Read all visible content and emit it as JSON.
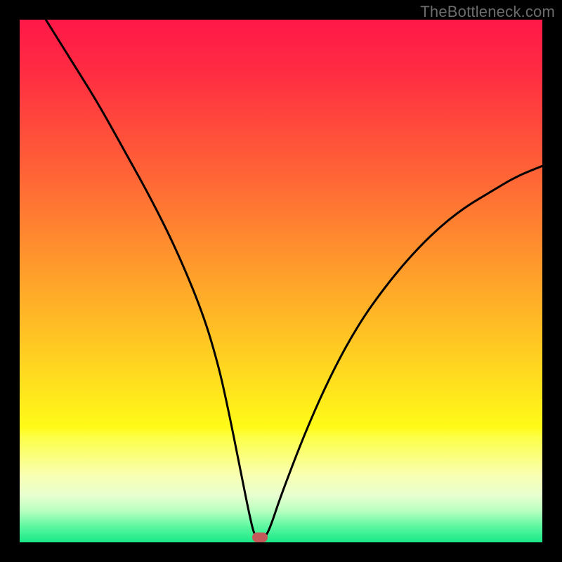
{
  "watermark": "TheBottleneck.com",
  "chart_data": {
    "type": "line",
    "title": "",
    "xlabel": "",
    "ylabel": "",
    "xlim": [
      0,
      100
    ],
    "ylim": [
      0,
      100
    ],
    "legend": false,
    "grid": false,
    "series": [
      {
        "name": "curve",
        "x": [
          5,
          10,
          15,
          20,
          25,
          30,
          35,
          38,
          40,
          42,
          44,
          45,
          46,
          47,
          48,
          50,
          55,
          60,
          65,
          70,
          75,
          80,
          85,
          90,
          95,
          100
        ],
        "y": [
          100,
          92,
          84,
          75,
          66,
          56,
          44,
          34,
          25,
          15,
          5,
          1,
          1,
          1,
          3,
          9,
          22,
          33,
          42,
          49,
          55,
          60,
          64,
          67,
          70,
          72
        ]
      }
    ],
    "marker": {
      "x": 46,
      "y": 1,
      "color": "#c35a59"
    },
    "background_gradient": {
      "stops": [
        {
          "pos": 0.0,
          "color": "#ff1848"
        },
        {
          "pos": 0.1,
          "color": "#ff2c42"
        },
        {
          "pos": 0.2,
          "color": "#ff493c"
        },
        {
          "pos": 0.3,
          "color": "#ff6536"
        },
        {
          "pos": 0.4,
          "color": "#ff8430"
        },
        {
          "pos": 0.5,
          "color": "#ffa32a"
        },
        {
          "pos": 0.6,
          "color": "#ffc224"
        },
        {
          "pos": 0.7,
          "color": "#ffe11e"
        },
        {
          "pos": 0.78,
          "color": "#fffb18"
        },
        {
          "pos": 0.8,
          "color": "#fdff4a"
        },
        {
          "pos": 0.87,
          "color": "#f9ffb0"
        },
        {
          "pos": 0.91,
          "color": "#e8ffd0"
        },
        {
          "pos": 0.94,
          "color": "#b8ffc0"
        },
        {
          "pos": 0.97,
          "color": "#5cf7a0"
        },
        {
          "pos": 1.0,
          "color": "#18e888"
        }
      ]
    }
  }
}
